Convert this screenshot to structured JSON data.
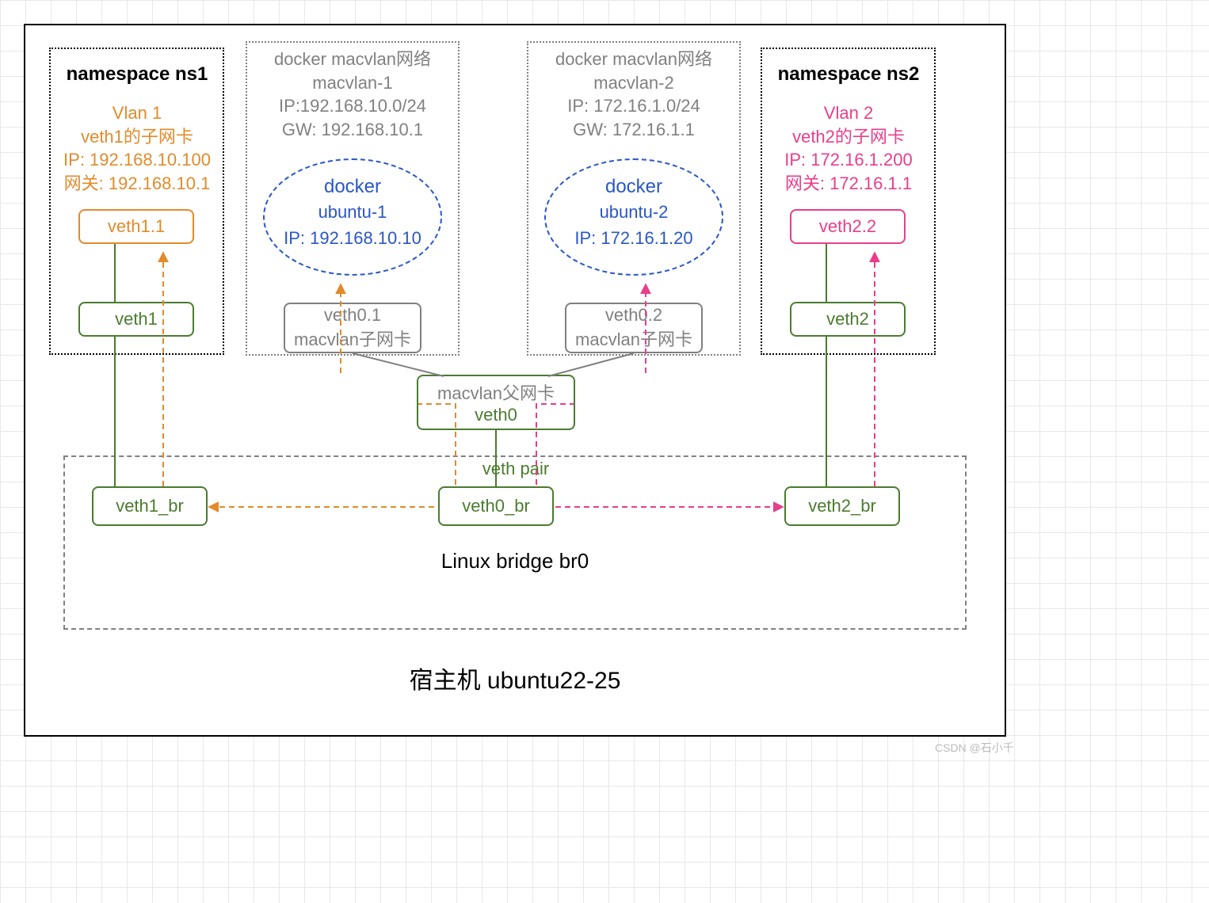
{
  "host": {
    "label": "宿主机 ubuntu22-25"
  },
  "bridge": {
    "label": "Linux bridge br0"
  },
  "vethPair": {
    "label": "veth  pair"
  },
  "ns1": {
    "title": "namespace ns1",
    "vlan_title": "Vlan 1",
    "sub_nic": "veth1的子网卡",
    "ip": "IP: 192.168.10.100",
    "gw": "网关: 192.168.10.1",
    "veth_sub": "veth1.1",
    "veth": "veth1"
  },
  "ns2": {
    "title": "namespace ns2",
    "vlan_title": "Vlan 2",
    "sub_nic": "veth2的子网卡",
    "ip": "IP: 172.16.1.200",
    "gw": "网关: 172.16.1.1",
    "veth_sub": "veth2.2",
    "veth": "veth2"
  },
  "mv1": {
    "title": "docker macvlan网络",
    "name": "macvlan-1",
    "ip": "IP:192.168.10.0/24",
    "gw": "GW: 192.168.10.1"
  },
  "mv2": {
    "title": "docker macvlan网络",
    "name": "macvlan-2",
    "ip": "IP: 172.16.1.0/24",
    "gw": "GW: 172.16.1.1"
  },
  "docker1": {
    "title": "docker",
    "name": "ubuntu-1",
    "ip": "IP: 192.168.10.10"
  },
  "docker2": {
    "title": "docker",
    "name": "ubuntu-2",
    "ip": "IP: 172.16.1.20"
  },
  "sub_nics": {
    "v01_name": "veth0.1",
    "v01_desc": "macvlan子网卡",
    "v02_name": "veth0.2",
    "v02_desc": "macvlan子网卡"
  },
  "parent_nic": {
    "desc": "macvlan父网卡",
    "name": "veth0"
  },
  "bridge_ports": {
    "v1": "veth1_br",
    "v0": "veth0_br",
    "v2": "veth2_br"
  },
  "watermark": "CSDN @石小千"
}
